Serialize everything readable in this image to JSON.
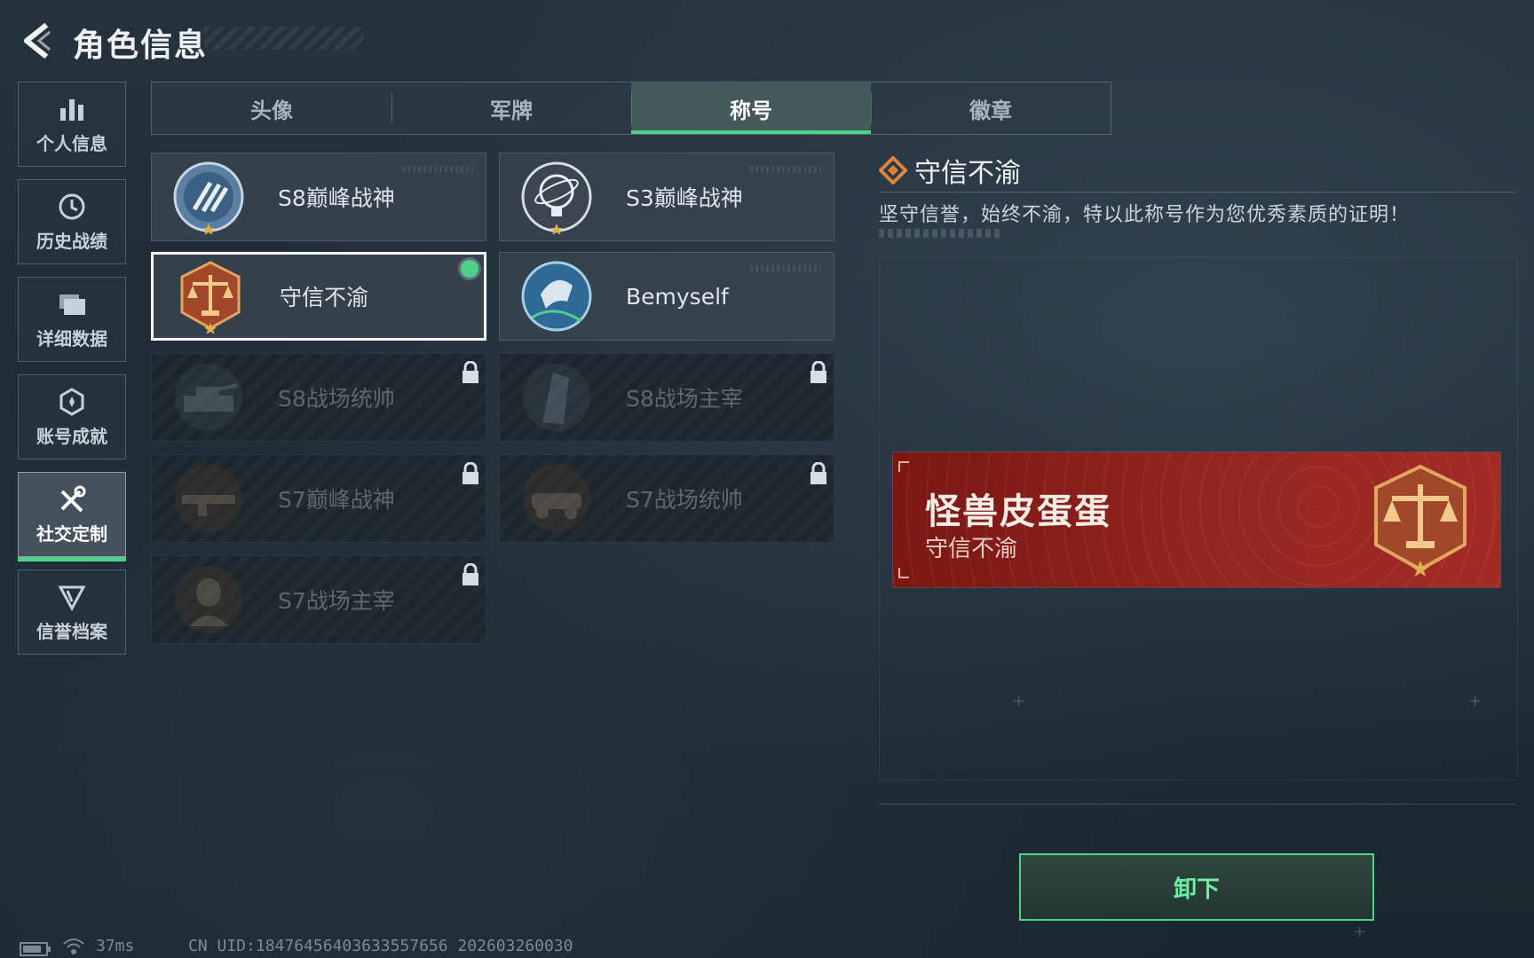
{
  "header": {
    "title": "角色信息"
  },
  "nav": {
    "items": [
      {
        "label": "个人信息",
        "icon": "bar-chart-icon"
      },
      {
        "label": "历史战绩",
        "icon": "history-icon"
      },
      {
        "label": "详细数据",
        "icon": "folder-icon"
      },
      {
        "label": "账号成就",
        "icon": "achievement-icon"
      },
      {
        "label": "社交定制",
        "icon": "tools-icon",
        "active": true
      },
      {
        "label": "信誉档案",
        "icon": "credit-icon"
      }
    ]
  },
  "tabs": [
    {
      "label": "头像"
    },
    {
      "label": "军牌"
    },
    {
      "label": "称号",
      "active": true
    },
    {
      "label": "徽章"
    }
  ],
  "titles": [
    {
      "name": "S8巅峰战神",
      "locked": false,
      "emblem": "blue-stripes-emblem"
    },
    {
      "name": "S3巅峰战神",
      "locked": false,
      "emblem": "globe-emblem"
    },
    {
      "name": "守信不渝",
      "locked": false,
      "selected": true,
      "equipped": true,
      "emblem": "scales-emblem"
    },
    {
      "name": "Bemyself",
      "locked": false,
      "emblem": "bemyself-emblem"
    },
    {
      "name": "S8战场统帅",
      "locked": true,
      "emblem": "tank-emblem"
    },
    {
      "name": "S8战场主宰",
      "locked": true,
      "emblem": "tower-emblem"
    },
    {
      "name": "S7巅峰战神",
      "locked": true,
      "emblem": "rifle-emblem"
    },
    {
      "name": "S7战场统帅",
      "locked": true,
      "emblem": "vehicle-emblem"
    },
    {
      "name": "S7战场主宰",
      "locked": true,
      "emblem": "soldier-emblem"
    }
  ],
  "detail": {
    "title": "守信不渝",
    "description": "坚守信誉，始终不渝，特以此称号作为您优秀素质的证明！"
  },
  "banner": {
    "player_name": "怪兽皮蛋蛋",
    "title": "守信不渝"
  },
  "actions": {
    "unequip_label": "卸下"
  },
  "status": {
    "ping": "37ms",
    "uid": "CN UID:18476456403633557656 202603260030"
  },
  "colors": {
    "accent_green": "#4fd18b",
    "banner_red": "#952521",
    "background": "#1e2b34"
  }
}
